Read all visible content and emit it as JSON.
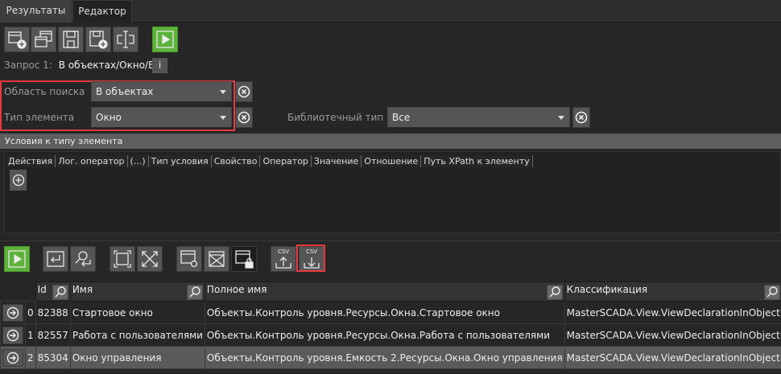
{
  "tabs": [
    {
      "label": "Результаты",
      "active": false
    },
    {
      "label": "Редактор",
      "active": true
    }
  ],
  "toolbar": {
    "icons": [
      "new-query-icon",
      "copy-query-icon",
      "save-icon",
      "save-as-icon",
      "rename-icon",
      "run-icon"
    ]
  },
  "query": {
    "label": "Запрос 1:",
    "value": "В объектах/Окно/Все",
    "info_label": "i"
  },
  "filters": {
    "search_area": {
      "label": "Область поиска",
      "value": "В объектах"
    },
    "element_type": {
      "label": "Тип элемента",
      "value": "Окно"
    },
    "library_type": {
      "label": "Библиотечный тип",
      "value": "Все"
    }
  },
  "conditions": {
    "title": "Условия к типу элемента",
    "columns": [
      "Действия",
      "Лог. оператор",
      "(...)",
      "Тип условия",
      "Свойство",
      "Оператор",
      "Значение",
      "Отношение",
      "Путь XPath к элементу"
    ]
  },
  "results_toolbar": {
    "csv_label": "CSV"
  },
  "table": {
    "columns": [
      "Id",
      "Имя",
      "Полное имя",
      "Классификация"
    ],
    "rows": [
      {
        "index": "0",
        "id": "82388",
        "name": "Стартовое окно",
        "full_name": "Объекты.Контроль уровня.Ресурсы.Окна.Стартовое окно",
        "class": "MasterSCADA.View.ViewDeclarationInObject"
      },
      {
        "index": "1",
        "id": "82557",
        "name": "Работа с пользователями",
        "full_name": "Объекты.Контроль уровня.Ресурсы.Окна.Работа с пользователями",
        "class": "MasterSCADA.View.ViewDeclarationInObject"
      },
      {
        "index": "2",
        "id": "85304",
        "name": "Окно управления",
        "full_name": "Объекты.Контроль уровня.Емкость 2.Ресурсы.Окна.Окно управления",
        "class": "MasterSCADA.View.ViewDeclarationInObject",
        "selected": true
      }
    ]
  },
  "colors": {
    "accent_green": "#5db33a",
    "highlight_red": "#e8393f"
  }
}
